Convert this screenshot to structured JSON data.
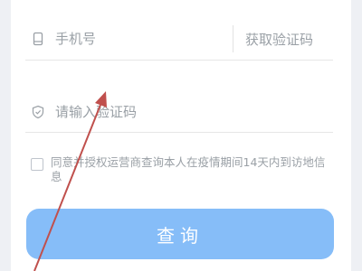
{
  "form": {
    "phone_placeholder": "手机号",
    "get_code_label": "获取验证码",
    "code_placeholder": "请输入验证码",
    "consent_text": "同意并授权运营商查询本人在疫情期间14天内到访地信息",
    "consent_checked": false,
    "submit_label": "查询"
  },
  "icons": {
    "phone": "mobile-phone-icon",
    "code": "shield-check-icon"
  },
  "colors": {
    "primary_button": "#86bdf8",
    "placeholder": "#9aa0a6",
    "annotation_arrow": "#c0504d"
  }
}
